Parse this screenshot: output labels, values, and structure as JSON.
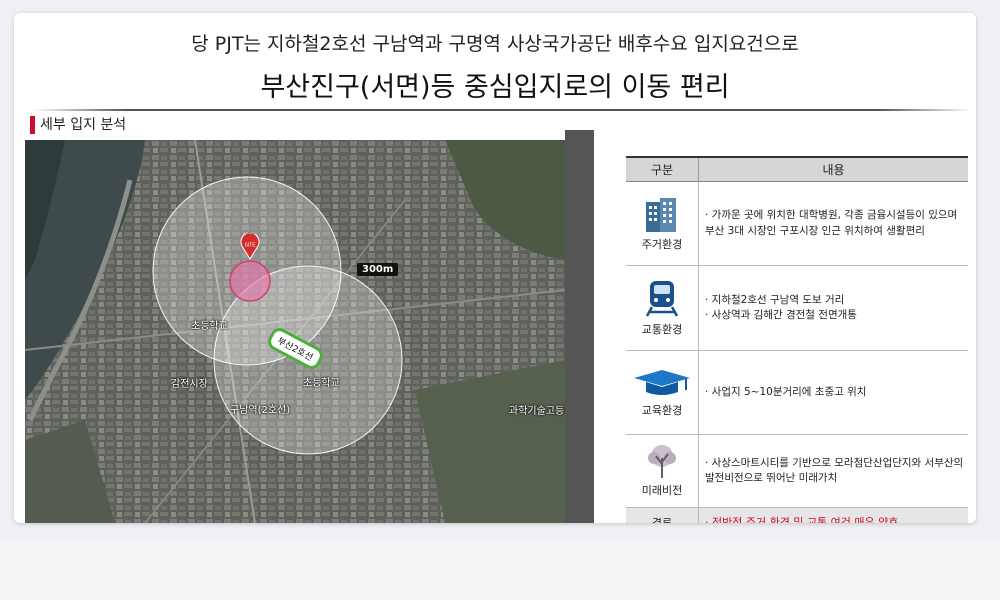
{
  "header": {
    "line1": "당 PJT는 지하철2호선 구남역과 구명역  사상국가공단 배후수요 입지요건으로",
    "line2": "부산진구(서면)등 중심입지로의 이동 편리"
  },
  "section": {
    "label": "세부 입지 분석"
  },
  "map": {
    "site_badge": "SITE",
    "radius_label": "300m",
    "line_badge": "부산2호선",
    "labels": {
      "school1": "초등학교",
      "school2": "초등학교",
      "market": "감전시장",
      "station": "구남역(2호선)",
      "highschool": "과학기술고등학교"
    }
  },
  "table": {
    "headers": [
      "구분",
      "내용"
    ],
    "rows": [
      {
        "category": "주거환경",
        "icon": "building-icon",
        "content": "· 가까운 곳에 위치한 대학병원, 각종 금융시설등이 있으며 부산 3대 시장인 구포시장 인근 위치하여 생활편리"
      },
      {
        "category": "교통환경",
        "icon": "train-icon",
        "content1": "· 지하철2호선 구남역 도보 거리",
        "content2": "· 사상역과 김해간 경전철 전면개통"
      },
      {
        "category": "교육환경",
        "icon": "graduation-cap-icon",
        "content": "· 사업지 5~10분거리에 초중고 위치"
      },
      {
        "category": "미래비전",
        "icon": "tree-icon",
        "content": "· 사상스마트시티를 기반으로 모라첨단산업단지와 서부산의 발전비전으로 뛰어난 미래가치"
      }
    ],
    "conclusion": {
      "category": "결론",
      "content": "· 전반적  주거 환경 및 교통 여건 매우 양호"
    }
  },
  "colors": {
    "accent": "#c8102e",
    "line2": "#4caf38"
  }
}
